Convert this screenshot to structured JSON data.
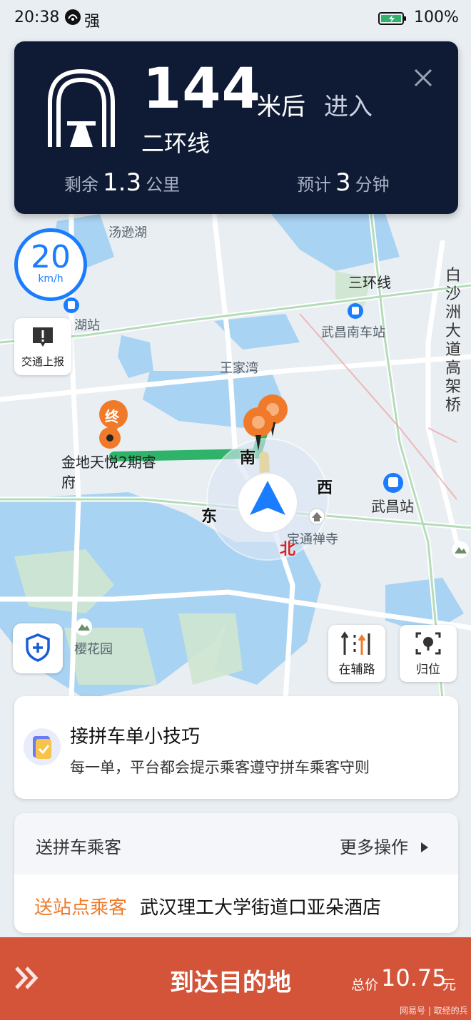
{
  "status_bar": {
    "time": "20:38",
    "signal": "强",
    "battery": "100%"
  },
  "navigation": {
    "distance": "144",
    "distance_unit": "米后",
    "action": "进入",
    "road": "二环线",
    "remaining_label": "剩余",
    "remaining_value": "1.3",
    "remaining_unit": "公里",
    "eta_label": "预计",
    "eta_value": "3",
    "eta_unit": "分钟"
  },
  "speed_limit": {
    "value": "20",
    "unit": "km/h"
  },
  "map": {
    "report_label": "交通上报",
    "aux_road_label": "在辅路",
    "locate_label": "归位",
    "labels": {
      "lake": "汤逊湖",
      "ring3": "三环线",
      "station1": "湖站",
      "wuchang_south": "武昌南车站",
      "wangjiawan": "王家湾",
      "baishazhou_1": "白",
      "baishazhou_2": "沙",
      "baishazhou_3": "洲",
      "baishazhou_4": "大",
      "baishazhou_5": "道",
      "baishazhou_6": "高",
      "baishazhou_7": "架",
      "baishazhou_8": "桥",
      "destination_badge": "终",
      "destination_name_1": "金地天悦2期睿",
      "destination_name_2": "府",
      "wuchang_station": "武昌站",
      "temple": "宝通禅寺",
      "sakura": "樱花园"
    },
    "compass": {
      "south": "南",
      "west": "西",
      "east": "东",
      "north": "北"
    },
    "colors": {
      "route_green": "#2fb36a",
      "route_yellow": "#f2c232",
      "accent_blue": "#1a7cff",
      "poi_orange": "#f07a2a"
    }
  },
  "tip": {
    "title": "接拼车单小技巧",
    "description": "每一单，平台都会提示乘客遵守拼车乘客守则"
  },
  "passenger": {
    "header": "送拼车乘客",
    "more_actions": "更多操作",
    "stop_label": "送站点乘客",
    "stop_name": "武汉理工大学街道口亚朵酒店"
  },
  "arrive": {
    "label": "到达目的地",
    "price_label": "总价",
    "price": "10.75",
    "price_unit": "元",
    "watermark": "网易号 | 取经的兵"
  }
}
